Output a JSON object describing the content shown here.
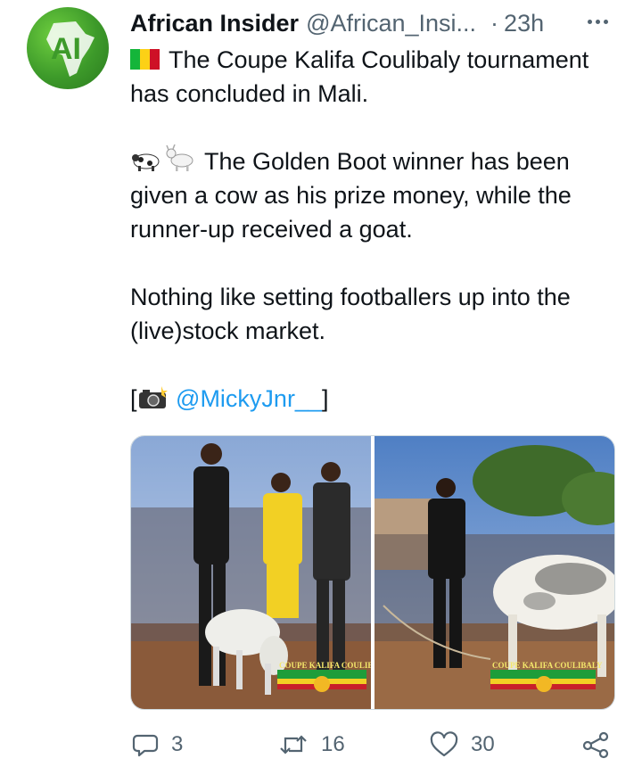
{
  "tweet": {
    "author_name": "African Insider",
    "author_handle": "@African_Insi...",
    "separator": "·",
    "timestamp": "23h",
    "line1": "The Coupe Kalifa Coulibaly tournament has concluded in Mali.",
    "line2": "The Golden Boot winner has been given a cow as his prize money, while the runner-up received a goat.",
    "line3": "Nothing like setting footballers up into the (live)stock market.",
    "credit_open": "[",
    "credit_mention": "@MickyJnr__",
    "credit_close": "]",
    "photo_banner_1": "COUPE KALIFA COULIBALY",
    "photo_banner_2": "COUPE KALIFA COULIBALY"
  },
  "actions": {
    "replies": "3",
    "retweets": "16",
    "likes": "30"
  },
  "icons": {
    "more": "more-horizontal-icon",
    "reply": "comment-bubble-icon",
    "retweet": "retweet-arrows-icon",
    "like": "heart-icon",
    "share": "share-icon",
    "flag": "mali-flag-icon",
    "camera": "camera-flash-icon"
  },
  "colors": {
    "link": "#1d9bf0",
    "secondary": "#536471",
    "text": "#0f1419"
  }
}
